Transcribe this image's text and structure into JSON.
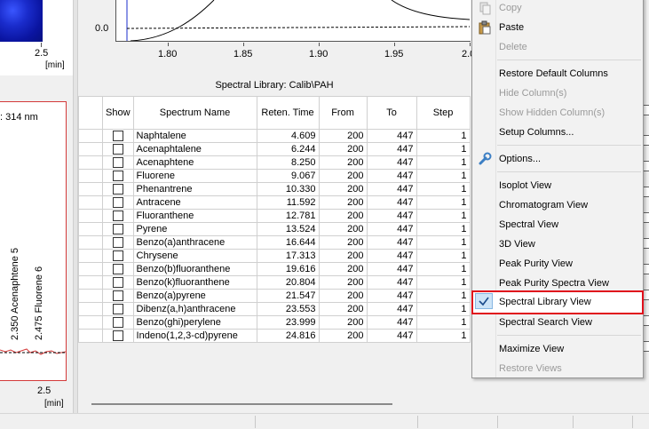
{
  "left_top": {
    "axis_tick": "2.5",
    "axis_unit": "[min]"
  },
  "left_bottom": {
    "wavelength_label": ": 314 nm",
    "peak_labels": [
      "2.350 Acenaphtene   5",
      "2.475 Fluorene   6"
    ],
    "axis_tick": "2.5",
    "axis_unit": "[min]"
  },
  "top_chart": {
    "y_tick": "0.0",
    "x_ticks": [
      "1.80",
      "1.85",
      "1.90",
      "1.95",
      "2.0"
    ]
  },
  "library": {
    "title": "Spectral Library: Calib\\PAH",
    "columns": [
      "Show",
      "Spectrum Name",
      "Reten. Time",
      "From",
      "To",
      "Step"
    ],
    "rows": [
      {
        "name": "Naphtalene",
        "rt": "4.609",
        "from": "200",
        "to": "447",
        "step": "1"
      },
      {
        "name": "Acenaphtalene",
        "rt": "6.244",
        "from": "200",
        "to": "447",
        "step": "1"
      },
      {
        "name": "Acenaphtene",
        "rt": "8.250",
        "from": "200",
        "to": "447",
        "step": "1"
      },
      {
        "name": "Fluorene",
        "rt": "9.067",
        "from": "200",
        "to": "447",
        "step": "1"
      },
      {
        "name": "Phenantrene",
        "rt": "10.330",
        "from": "200",
        "to": "447",
        "step": "1"
      },
      {
        "name": "Antracene",
        "rt": "11.592",
        "from": "200",
        "to": "447",
        "step": "1"
      },
      {
        "name": "Fluoranthene",
        "rt": "12.781",
        "from": "200",
        "to": "447",
        "step": "1"
      },
      {
        "name": "Pyrene",
        "rt": "13.524",
        "from": "200",
        "to": "447",
        "step": "1"
      },
      {
        "name": "Benzo(a)anthracene",
        "rt": "16.644",
        "from": "200",
        "to": "447",
        "step": "1"
      },
      {
        "name": "Chrysene",
        "rt": "17.313",
        "from": "200",
        "to": "447",
        "step": "1"
      },
      {
        "name": "Benzo(b)fluoranthene",
        "rt": "19.616",
        "from": "200",
        "to": "447",
        "step": "1"
      },
      {
        "name": "Benzo(k)fluoranthene",
        "rt": "20.804",
        "from": "200",
        "to": "447",
        "step": "1"
      },
      {
        "name": "Benzo(a)pyrene",
        "rt": "21.547",
        "from": "200",
        "to": "447",
        "step": "1"
      },
      {
        "name": "Dibenz(a,h)anthracene",
        "rt": "23.553",
        "from": "200",
        "to": "447",
        "step": "1"
      },
      {
        "name": "Benzo(ghi)perylene",
        "rt": "23.999",
        "from": "200",
        "to": "447",
        "step": "1"
      },
      {
        "name": "Indeno(1,2,3-cd)pyrene",
        "rt": "24.816",
        "from": "200",
        "to": "447",
        "step": "1"
      }
    ]
  },
  "context_menu": {
    "items": {
      "copy": "Copy",
      "paste": "Paste",
      "delete": "Delete",
      "restore_columns": "Restore Default Columns",
      "hide_columns": "Hide Column(s)",
      "show_hidden": "Show Hidden Column(s)",
      "setup_columns": "Setup Columns...",
      "options": "Options...",
      "isoplot": "Isoplot View",
      "chromatogram": "Chromatogram View",
      "spectral": "Spectral View",
      "view3d": "3D View",
      "peak_purity": "Peak Purity View",
      "peak_purity_spectra": "Peak Purity Spectra View",
      "spectral_library": "Spectral Library View",
      "spectral_search": "Spectral Search View",
      "maximize": "Maximize View",
      "restore_views": "Restore Views"
    },
    "checked_item": "Spectral Library View",
    "highlight_color": "#e0101c"
  }
}
